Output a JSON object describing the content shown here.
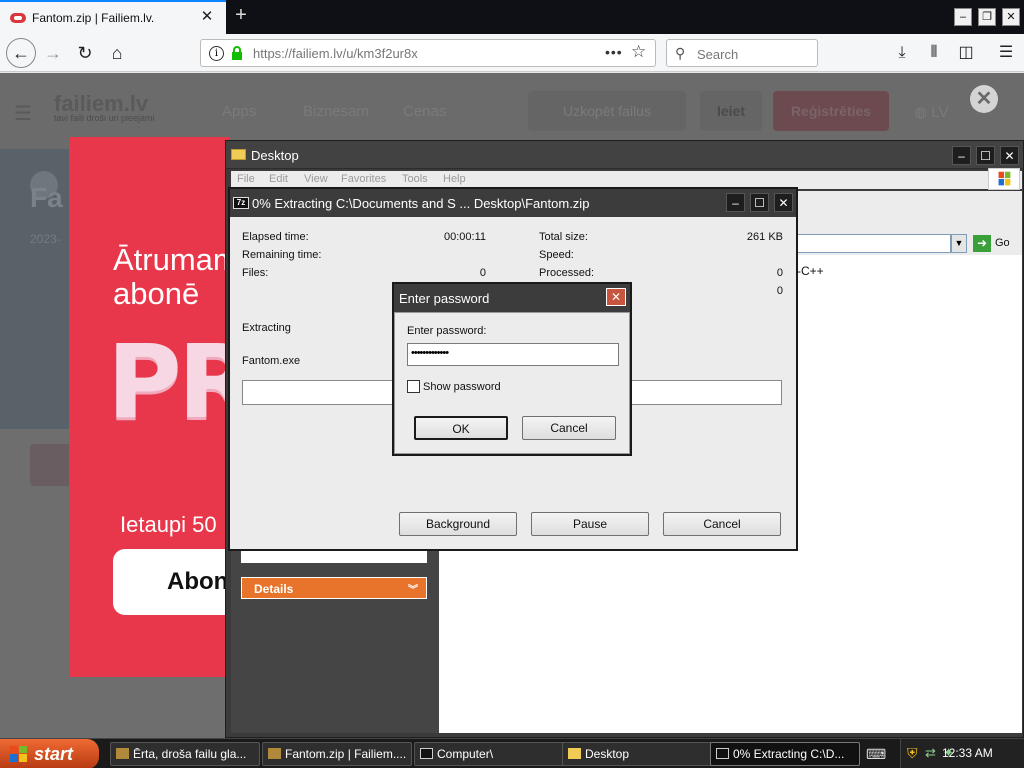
{
  "browser": {
    "tab_title": "Fantom.zip | Failiem.lv.",
    "url_host": "https://failiem.lv",
    "url_path": "/u/km3f2ur8x",
    "search_placeholder": "Search",
    "accent": "#0a84ff"
  },
  "site": {
    "logo": "failiem.lv",
    "logo_tagline": "tavi faili droši un pieejami",
    "nav": [
      "Apps",
      "Biznesam",
      "Cenas"
    ],
    "upload_label": "Uzkopēt failus",
    "login_label": "Ieiet",
    "register_label": "Reģistrēties",
    "lang_label": "LV",
    "ghost_title": "Fa",
    "ghost_date": "2023-"
  },
  "promo": {
    "line1": "Ātrumam",
    "line2": "abonē",
    "big": "PR",
    "savings": "Ietaupi 50",
    "button": "Abon",
    "color": "#e8374a"
  },
  "explorer": {
    "title": "Desktop",
    "menu": [
      "File",
      "Edit",
      "View",
      "Favorites",
      "Tools",
      "Help"
    ],
    "go_label": "Go",
    "details_label": "Details",
    "content_fragment": "-C++"
  },
  "zip": {
    "title": "0% Extracting C:\\Documents and S ... Desktop\\Fantom.zip",
    "elapsed_label": "Elapsed time:",
    "elapsed_value": "00:00:11",
    "remaining_label": "Remaining time:",
    "files_label": "Files:",
    "files_value": "0",
    "total_label": "Total size:",
    "total_value": "261 KB",
    "speed_label": "Speed:",
    "processed_label": "Processed:",
    "processed_value": "0",
    "extra_value": "0",
    "extracting_label": "Extracting",
    "current_file": "Fantom.exe",
    "progress": 0,
    "background_label": "Background",
    "pause_label": "Pause",
    "cancel_label": "Cancel"
  },
  "password_dialog": {
    "title": "Enter password",
    "prompt": "Enter password:",
    "masked_value": "•••••••••••••",
    "show_password_label": "Show password",
    "show_password_checked": false,
    "ok_label": "OK",
    "cancel_label": "Cancel"
  },
  "taskbar": {
    "start_label": "start",
    "tasks": [
      "Ērta, droša failu gla...",
      "Fantom.zip | Failiem....",
      "Computer\\",
      "Desktop",
      "0% Extracting C:\\D..."
    ],
    "clock": "12:33 AM"
  }
}
